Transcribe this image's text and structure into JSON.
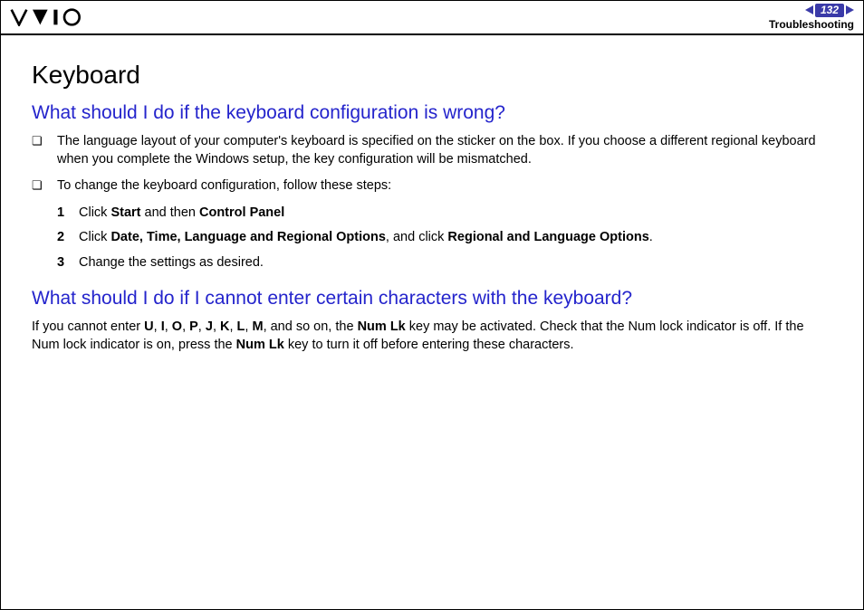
{
  "header": {
    "page_number": "132",
    "section": "Troubleshooting"
  },
  "content": {
    "title": "Keyboard",
    "q1": {
      "heading": "What should I do if the keyboard configuration is wrong?",
      "bullet1": "The language layout of your computer's keyboard is specified on the sticker on the box. If you choose a different regional keyboard when you complete the Windows setup, the key configuration will be mismatched.",
      "bullet2": "To change the keyboard configuration, follow these steps:",
      "steps": {
        "n1": "1",
        "s1a": "Click ",
        "s1b": "Start",
        "s1c": " and then ",
        "s1d": "Control Panel",
        "n2": "2",
        "s2a": "Click ",
        "s2b": "Date, Time, Language and Regional Options",
        "s2c": ", and click ",
        "s2d": "Regional and Language Options",
        "s2e": ".",
        "n3": "3",
        "s3": "Change the settings as desired."
      }
    },
    "q2": {
      "heading": "What should I do if I cannot enter certain characters with the keyboard?",
      "p_a": "If you cannot enter ",
      "u": "U",
      "c1": ", ",
      "i": "I",
      "c2": ", ",
      "o": "O",
      "c3": ", ",
      "p": "P",
      "c4": ", ",
      "j": "J",
      "c5": ", ",
      "k": "K",
      "c6": ", ",
      "l": "L",
      "c7": ", ",
      "m": "M",
      "p_b": ", and so on, the ",
      "numlk1": "Num Lk",
      "p_c": " key may be activated. Check that the Num lock indicator is off. If the Num lock indicator is on, press the ",
      "numlk2": "Num Lk",
      "p_d": " key to turn it off before entering these characters."
    }
  }
}
